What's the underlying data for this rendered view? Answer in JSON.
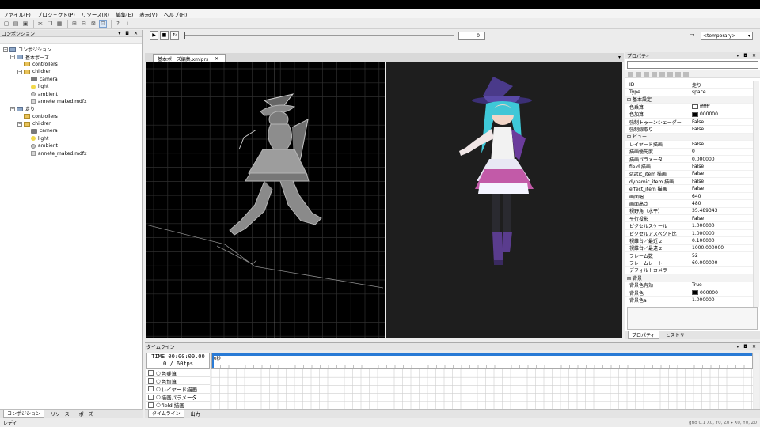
{
  "menu": [
    "ファイル(F)",
    "プロジェクト(P)",
    "リソース(R)",
    "編集(E)",
    "表示(V)",
    "ヘルプ(H)"
  ],
  "left_panel": {
    "title": "コンポジション",
    "tree": [
      {
        "label": "コンポジション",
        "level": 0,
        "icon": "comp",
        "exp": "−"
      },
      {
        "label": "基本ポーズ",
        "level": 1,
        "icon": "comp",
        "exp": "−"
      },
      {
        "label": "controllers",
        "level": 2,
        "icon": "folder",
        "exp": ""
      },
      {
        "label": "children",
        "level": 2,
        "icon": "folder",
        "exp": "−"
      },
      {
        "label": "camera",
        "level": 3,
        "icon": "cam",
        "exp": ""
      },
      {
        "label": "light",
        "level": 3,
        "icon": "light",
        "exp": ""
      },
      {
        "label": "ambient",
        "level": 3,
        "icon": "amb",
        "exp": ""
      },
      {
        "label": "annete_maked.mdfx",
        "level": 3,
        "icon": "file",
        "exp": ""
      },
      {
        "label": "走り",
        "level": 1,
        "icon": "comp",
        "exp": "−"
      },
      {
        "label": "controllers",
        "level": 2,
        "icon": "folder",
        "exp": ""
      },
      {
        "label": "children",
        "level": 2,
        "icon": "folder",
        "exp": "−"
      },
      {
        "label": "camera",
        "level": 3,
        "icon": "cam",
        "exp": ""
      },
      {
        "label": "light",
        "level": 3,
        "icon": "light",
        "exp": ""
      },
      {
        "label": "ambient",
        "level": 3,
        "icon": "amb",
        "exp": ""
      },
      {
        "label": "annete_maked.mdfx",
        "level": 3,
        "icon": "file",
        "exp": ""
      }
    ],
    "tabs": [
      "コンポジション",
      "リソース",
      "ポーズ"
    ]
  },
  "playback": {
    "frame": "0",
    "camera_select": "<temporary>"
  },
  "document_tab": "基本ポーズ編集.xmlprs",
  "properties": {
    "title": "プロパティ",
    "rows": [
      {
        "k": "ID",
        "v": "走り"
      },
      {
        "k": "Type",
        "v": "space"
      },
      {
        "k": "基本設定",
        "v": "",
        "group": true
      },
      {
        "k": "色乗算",
        "v": "ffffff",
        "swatch": "#ffffff"
      },
      {
        "k": "色加算",
        "v": "000000",
        "swatch": "#000000"
      },
      {
        "k": "強制トゥーンシェーダー",
        "v": "False"
      },
      {
        "k": "強制線取り",
        "v": "False"
      },
      {
        "k": "ビュー",
        "v": "",
        "group": true
      },
      {
        "k": "レイヤード描画",
        "v": "False"
      },
      {
        "k": "描画優先度",
        "v": "0"
      },
      {
        "k": "描画パラメータ",
        "v": "0.000000"
      },
      {
        "k": "field 描画",
        "v": "False"
      },
      {
        "k": "static_item 描画",
        "v": "False"
      },
      {
        "k": "dynamic_item 描画",
        "v": "False"
      },
      {
        "k": "effect_item 描画",
        "v": "False"
      },
      {
        "k": "画面幅",
        "v": "640"
      },
      {
        "k": "画面高さ",
        "v": "480"
      },
      {
        "k": "視野角（水平）",
        "v": "35.489343"
      },
      {
        "k": "平行投影",
        "v": "False"
      },
      {
        "k": "ピクセルスケール",
        "v": "1.000000"
      },
      {
        "k": "ピクセルアスペクト比",
        "v": "1.000000"
      },
      {
        "k": "視錐台／最近 z",
        "v": "0.100000"
      },
      {
        "k": "視錐台／最遠 z",
        "v": "1000.000000"
      },
      {
        "k": "フレーム数",
        "v": "52"
      },
      {
        "k": "フレームレート",
        "v": "60.000000"
      },
      {
        "k": "デフォルトカメラ",
        "v": ""
      },
      {
        "k": "背景",
        "v": "",
        "group": true
      },
      {
        "k": "背景色有効",
        "v": "True"
      },
      {
        "k": "背景色",
        "v": "000000",
        "swatch": "#000000"
      },
      {
        "k": "背景色a",
        "v": "1.000000"
      }
    ],
    "tabs": [
      "プロパティ",
      "ヒストリ"
    ]
  },
  "timeline": {
    "title": "タイムライン",
    "time": "TIME 00:00:00.00",
    "frames": "0 / 60fps",
    "ruler_label": "0秒",
    "tracks": [
      "色乗算",
      "色加算",
      "レイヤード描画",
      "描画パラメータ",
      "field 描画"
    ],
    "tabs": [
      "タイムライン",
      "出力"
    ]
  },
  "status": {
    "left": "レディ",
    "right": "grid 0.1  X0, Y0, Z0  ▸ X0, Y0, Z0"
  }
}
